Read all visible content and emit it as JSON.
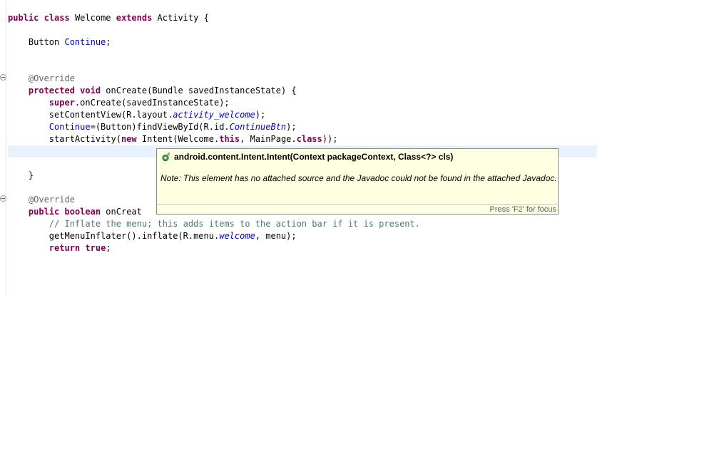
{
  "colors": {
    "keyword": "#7f0055",
    "field": "#0000c0",
    "annotation": "#646464",
    "comment": "#3f7f5f",
    "current_line": "#e8f2fe",
    "hover_background": "#ffffe1"
  },
  "code": {
    "line1": {
      "t1": "public",
      "t2": " ",
      "t3": "class",
      "t4": " Welcome ",
      "t5": "extends",
      "t6": " Activity {"
    },
    "line2": {
      "t1": "    Button ",
      "t2": "Continue",
      "t3": ";"
    },
    "line3": {
      "t1": "    @Override"
    },
    "line4": {
      "t1": "    ",
      "t2": "protected",
      "t3": " ",
      "t4": "void",
      "t5": " onCreate(Bundle savedInstanceState) {"
    },
    "line5": {
      "t1": "        ",
      "t2": "super",
      "t3": ".onCreate(savedInstanceState);"
    },
    "line6": {
      "t1": "        setContentView(R.layout.",
      "t2": "activity_welcome",
      "t3": ");"
    },
    "line7": {
      "t1": "        ",
      "t2": "Continue",
      "t3": "=(Button)findViewById(R.id.",
      "t4": "ContinueBtn",
      "t5": ");"
    },
    "line8": {
      "t1": "        startActivity(",
      "t2": "new",
      "t3": " Intent(Welcome.",
      "t4": "this",
      "t5": ", MainPage.",
      "t6": "class",
      "t7": "));"
    },
    "line9": {
      "t1": "    }"
    },
    "line10": {
      "t1": "    @Override"
    },
    "line11": {
      "t1": "    ",
      "t2": "public",
      "t3": " ",
      "t4": "boolean",
      "t5": " onCreat"
    },
    "line12": {
      "t1": "        // Inflate the menu; this adds items to the action bar if it is present."
    },
    "line13": {
      "t1": "        getMenuInflater().inflate(R.menu.",
      "t2": "welcome",
      "t3": ", menu);"
    },
    "line14": {
      "t1": "        ",
      "t2": "return",
      "t3": " ",
      "t4": "true",
      "t5": ";"
    }
  },
  "hover": {
    "icon": "constructor-icon",
    "signature": "android.content.Intent.Intent(Context packageContext, Class<?> cls)",
    "note": "Note: This element has no attached source and the Javadoc could not be found in the attached Javadoc.",
    "status": "Press 'F2' for focus"
  }
}
